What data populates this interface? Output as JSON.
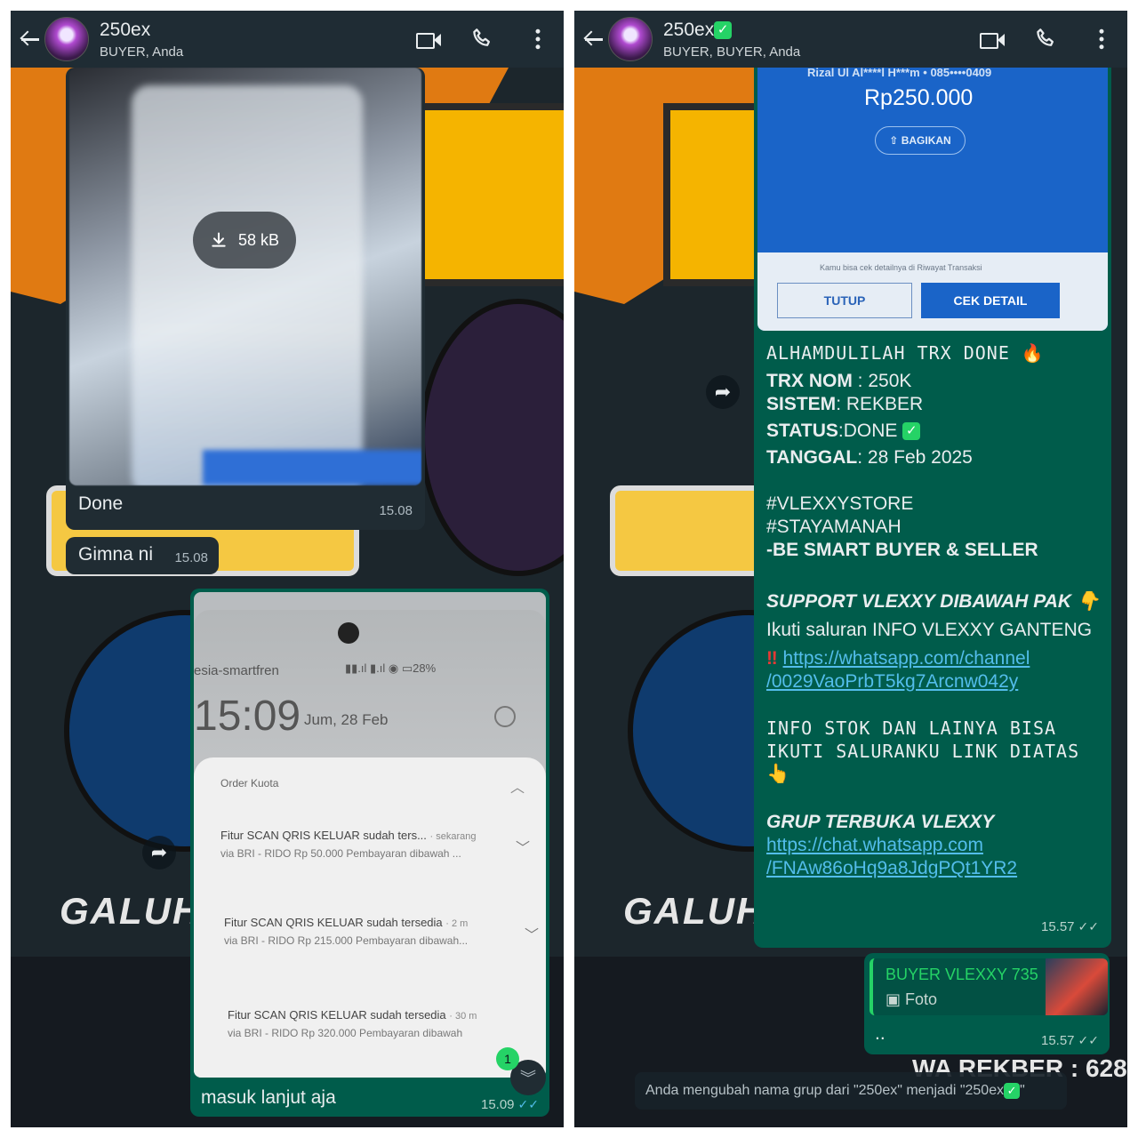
{
  "left": {
    "header": {
      "title": "250ex",
      "subtitle": "BUYER, Anda"
    },
    "msg_photo1": {
      "download_size": "58 kB",
      "caption": "Done",
      "time": "15.08"
    },
    "msg_gimna": {
      "text": "Gimna ni",
      "time": "15.08"
    },
    "msg_photo2": {
      "carrier": "esia-smartfren",
      "status_time": "15:09",
      "status_date": "Jum, 28 Feb",
      "battery": "28",
      "notif_app": "Order Kuota",
      "notifs": [
        {
          "title": "Fitur SCAN QRIS KELUAR sudah ters...",
          "age": "· sekarang",
          "body": "via BRI - RIDO Rp 50.000 Pembayaran dibawah ..."
        },
        {
          "title": "Fitur SCAN QRIS KELUAR sudah tersedia",
          "age": "· 2 m",
          "body": "via BRI - RIDO Rp 215.000 Pembayaran dibawah..."
        },
        {
          "title": "Fitur SCAN QRIS KELUAR sudah tersedia",
          "age": "· 30 m",
          "body": "via BRI - RIDO Rp 320.000 Pembayaran dibawah"
        }
      ],
      "caption": "masuk lanjut aja",
      "time": "15.09",
      "unread": "1"
    },
    "wallpaper_text": "GALUH"
  },
  "right": {
    "header": {
      "title": "250ex",
      "subtitle": "BUYER, BUYER, Anda"
    },
    "receipt": {
      "recipient": "Rizal Ul Al****l H***m • 085••••0409",
      "amount": "Rp250.000",
      "share": "BAGIKAN",
      "note": "Kamu bisa cek detailnya di Riwayat Transaksi",
      "btn_close": "TUTUP",
      "btn_detail": "CEK DETAIL"
    },
    "post": {
      "line1": "ALHAMDULILAH TRX DONE",
      "trx_label": "TRX NOM",
      "trx_value": " : 250K",
      "sistem_label": "SISTEM",
      "sistem_value": ": REKBER",
      "status_label": "STATUS",
      "status_value": ":DONE",
      "tanggal_label": "TANGGAL",
      "tanggal_value": ": 28 Feb 2025",
      "tag1": "#VLEXXYSTORE",
      "tag2": "#STAYAMANAH",
      "tag3": "-BE SMART BUYER & SELLER",
      "support": "SUPPORT VLEXXY DIBAWAH PAK",
      "ikuti": "Ikuti saluran INFO VLEXXY GANTENG",
      "channel_link_1": "https://whatsapp.com/channel",
      "channel_link_2": "/0029VaoPrbT5kg7Arcnw042y",
      "info1": "INFO STOK DAN LAINYA BISA",
      "info2": "IKUTI SALURANKU LINK DIATAS",
      "grup": "GRUP TERBUKA VLEXXY",
      "grup_link_1": "https://chat.whatsapp.com",
      "grup_link_2": "/FNAw86oHq9a8JdgPQt1YR2",
      "time": "15.57"
    },
    "reply": {
      "author": "BUYER VLEXXY 735",
      "type": "Foto",
      "text": "..",
      "time": "15.57"
    },
    "system": "Anda mengubah nama grup dari \"250ex\" menjadi \"250ex",
    "wallpaper_text": "GALUH",
    "wa_rekber": "WA REKBER : 628"
  },
  "colors": {
    "incoming": "#202c33",
    "outgoing": "#005c4b",
    "header": "#1f2c34",
    "link": "#53bdeb",
    "check": "#53bdeb"
  }
}
